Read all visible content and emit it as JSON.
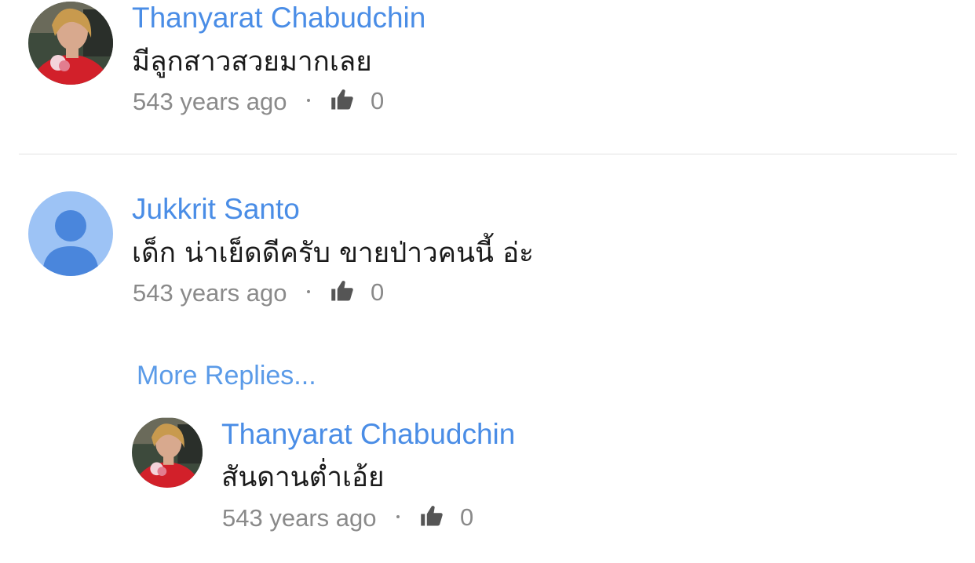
{
  "comments": [
    {
      "author": "Thanyarat Chabudchin",
      "text": "มีลูกสาวสวยมากเลย",
      "time": "543 years ago",
      "likes": "0",
      "avatar": "user-photo-avatar"
    },
    {
      "author": "Jukkrit Santo",
      "text": "เด็ก น่าเย็ดดีครับ ขายป่าวคนนี้ อ่ะ",
      "time": "543 years ago",
      "likes": "0",
      "avatar": "default-person-avatar"
    }
  ],
  "more_replies_label": "More Replies...",
  "replies": [
    {
      "author": "Thanyarat Chabudchin",
      "text": "สันดานต่ำเอ้ย",
      "time": "543 years ago",
      "likes": "0",
      "avatar": "user-photo-avatar"
    }
  ],
  "colors": {
    "author": "#4a8de6",
    "link": "#5b9be8",
    "meta": "#8a8a8a",
    "text": "#1a1a1a",
    "divider": "#e2e2e2",
    "default_avatar_bg": "#9dc3f5",
    "default_avatar_fg": "#4a86dc"
  },
  "icons": {
    "like": "thumbs-up-icon"
  }
}
